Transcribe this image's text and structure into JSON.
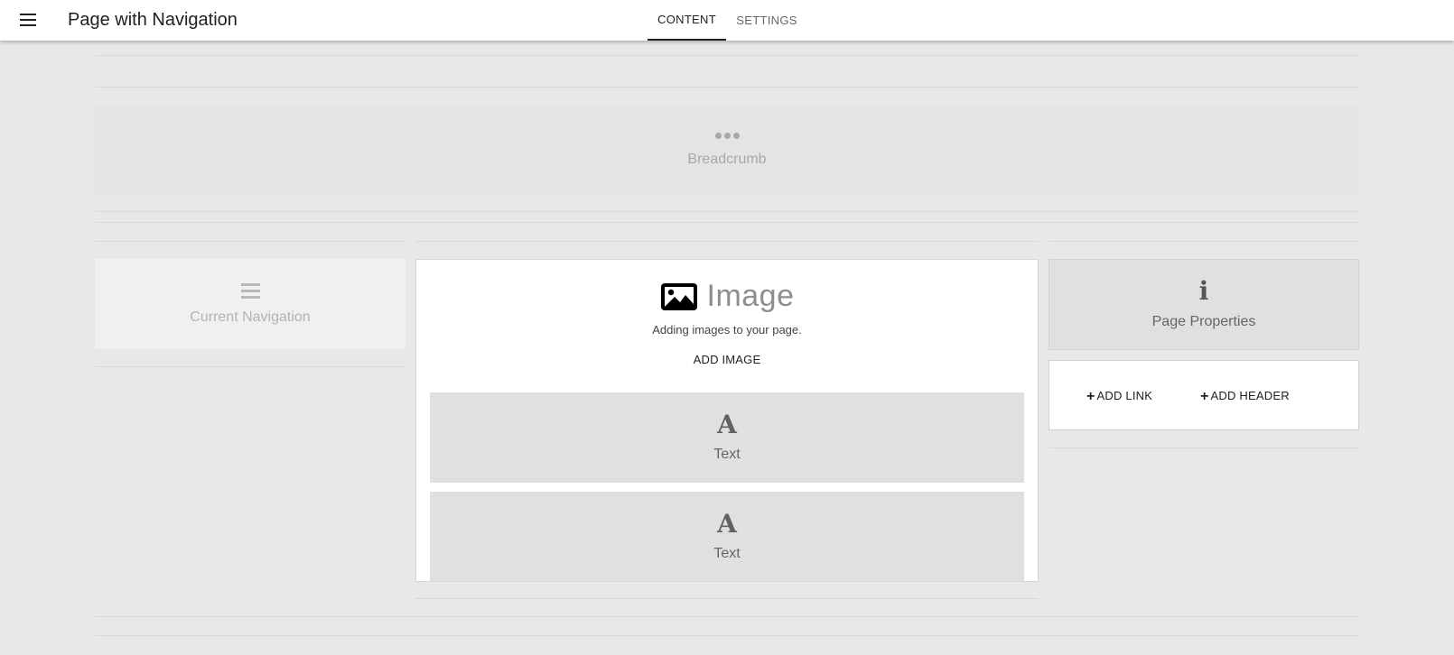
{
  "appbar": {
    "menu_icon": "menu-icon",
    "title": "Page with Navigation",
    "tabs": [
      {
        "label": "CONTENT",
        "active": true
      },
      {
        "label": "SETTINGS",
        "active": false
      }
    ]
  },
  "breadcrumb": {
    "icon": "more-horiz-icon",
    "label": "Breadcrumb"
  },
  "current_navigation": {
    "icon": "list-icon",
    "label": "Current Navigation"
  },
  "image_widget": {
    "icon": "image-icon",
    "title": "Image",
    "description": "Adding images to your page.",
    "add_label": "ADD IMAGE"
  },
  "text_blocks": [
    {
      "icon": "text-icon",
      "glyph": "A",
      "label": "Text"
    },
    {
      "icon": "text-icon",
      "glyph": "A",
      "label": "Text"
    }
  ],
  "page_properties": {
    "icon": "info-icon",
    "glyph": "i",
    "label": "Page Properties"
  },
  "link_actions": {
    "plus": "+",
    "add_link": "ADD LINK",
    "add_header": "ADD HEADER"
  },
  "colors": {
    "background": "#e8e8e8",
    "appbar": "#ffffff",
    "placeholder_block": "#e0e0e0"
  }
}
